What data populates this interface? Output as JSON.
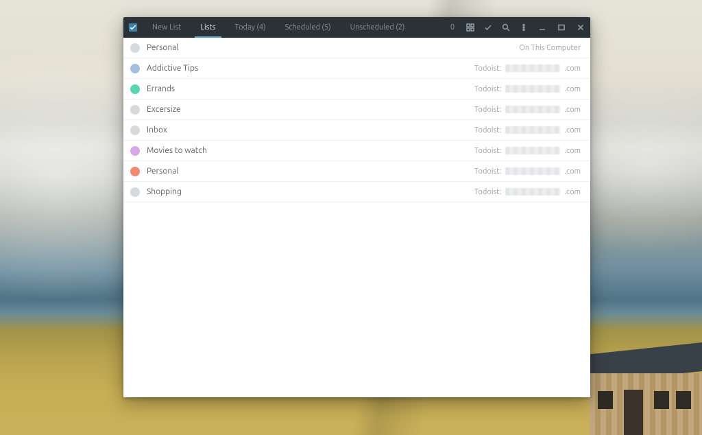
{
  "header": {
    "new_list_label": "New List",
    "tabs": [
      {
        "id": "lists",
        "label": "Lists",
        "active": true
      },
      {
        "id": "today",
        "label": "Today (4)",
        "active": false
      },
      {
        "id": "scheduled",
        "label": "Scheduled (5)",
        "active": false
      },
      {
        "id": "unscheduled",
        "label": "Unscheduled (2)",
        "active": false
      }
    ],
    "count_badge": "0"
  },
  "lists": [
    {
      "name": "Personal",
      "color": "#d7dadc",
      "source_prefix": "",
      "source_suffix": "On This Computer",
      "has_blur": false
    },
    {
      "name": "Addictive Tips",
      "color": "#a6bfe0",
      "source_prefix": "Todoist:",
      "source_suffix": ".com",
      "has_blur": true
    },
    {
      "name": "Errands",
      "color": "#57d6b1",
      "source_prefix": "Todoist:",
      "source_suffix": ".com",
      "has_blur": true
    },
    {
      "name": "Excersize",
      "color": "#d7dadc",
      "source_prefix": "Todoist:",
      "source_suffix": ".com",
      "has_blur": true
    },
    {
      "name": "Inbox",
      "color": "#d7dadc",
      "source_prefix": "Todoist:",
      "source_suffix": ".com",
      "has_blur": true
    },
    {
      "name": "Movies to watch",
      "color": "#d6a9e6",
      "source_prefix": "Todoist:",
      "source_suffix": ".com",
      "has_blur": true
    },
    {
      "name": "Personal",
      "color": "#f08b6f",
      "source_prefix": "Todoist:",
      "source_suffix": ".com",
      "has_blur": true
    },
    {
      "name": "Shopping",
      "color": "#d7dadc",
      "source_prefix": "Todoist:",
      "source_suffix": ".com",
      "has_blur": true
    }
  ]
}
